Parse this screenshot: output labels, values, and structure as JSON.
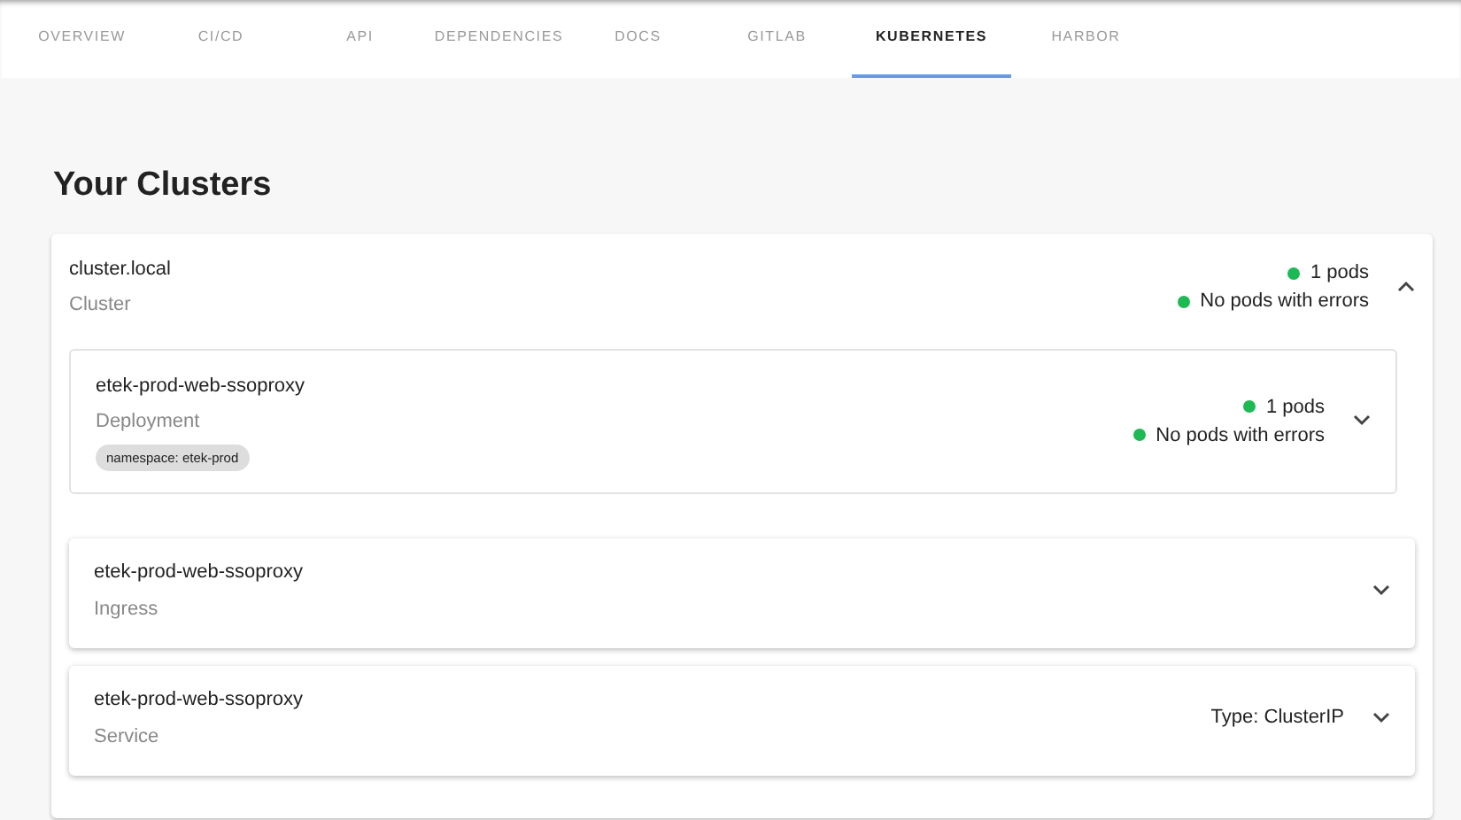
{
  "tabs": [
    {
      "label": "OVERVIEW",
      "selected": false
    },
    {
      "label": "CI/CD",
      "selected": false
    },
    {
      "label": "API",
      "selected": false
    },
    {
      "label": "DEPENDENCIES",
      "selected": false
    },
    {
      "label": "DOCS",
      "selected": false
    },
    {
      "label": "GITLAB",
      "selected": false
    },
    {
      "label": "KUBERNETES",
      "selected": true
    },
    {
      "label": "HARBOR",
      "selected": false
    }
  ],
  "heading": "Your Clusters",
  "cluster": {
    "name": "cluster.local",
    "type": "Cluster",
    "expanded": true,
    "statuses": [
      {
        "text": "1 pods",
        "color": "#1db954"
      },
      {
        "text": "No pods with errors",
        "color": "#1db954"
      }
    ],
    "resources": [
      {
        "kind": "deployment",
        "name": "etek-prod-web-ssoproxy",
        "type": "Deployment",
        "expanded": false,
        "chip": "namespace: etek-prod",
        "statuses": [
          {
            "text": "1 pods",
            "color": "#1db954"
          },
          {
            "text": "No pods with errors",
            "color": "#1db954"
          }
        ]
      },
      {
        "kind": "ingress",
        "name": "etek-prod-web-ssoproxy",
        "type": "Ingress",
        "expanded": false
      },
      {
        "kind": "service",
        "name": "etek-prod-web-ssoproxy",
        "type": "Service",
        "expanded": false,
        "info": "Type: ClusterIP"
      }
    ]
  }
}
